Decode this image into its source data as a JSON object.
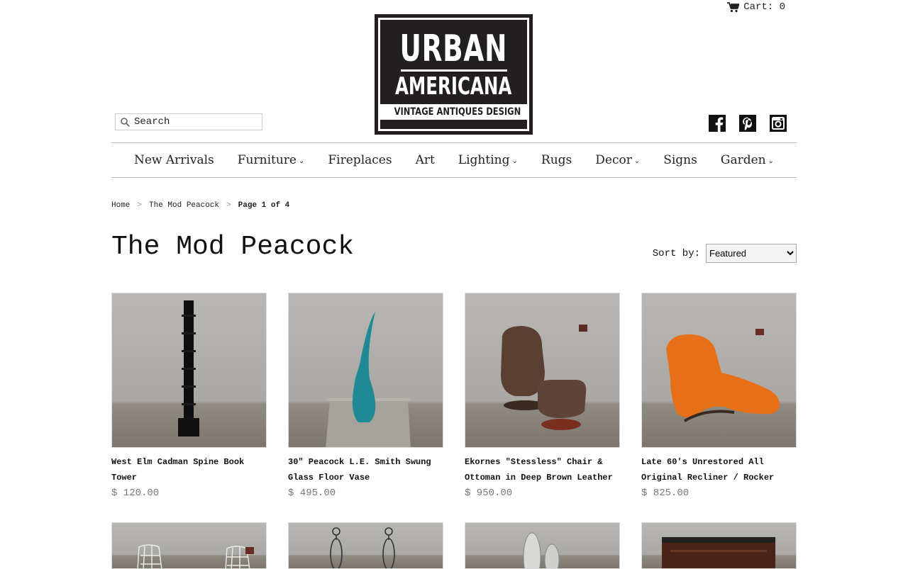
{
  "header": {
    "cart_label": "Cart: 0",
    "logo": {
      "line1": "URBAN",
      "line2": "AMERICANA",
      "tagline": "VINTAGE ANTIQUES DESIGN"
    },
    "search_placeholder": "Search",
    "social": [
      "facebook-icon",
      "pinterest-icon",
      "instagram-icon"
    ]
  },
  "nav": {
    "items": [
      {
        "label": "New Arrivals",
        "has_dropdown": false
      },
      {
        "label": "Furniture",
        "has_dropdown": true
      },
      {
        "label": "Fireplaces",
        "has_dropdown": false
      },
      {
        "label": "Art",
        "has_dropdown": false
      },
      {
        "label": "Lighting",
        "has_dropdown": true
      },
      {
        "label": "Rugs",
        "has_dropdown": false
      },
      {
        "label": "Decor",
        "has_dropdown": true
      },
      {
        "label": "Signs",
        "has_dropdown": false
      },
      {
        "label": "Garden",
        "has_dropdown": true
      }
    ]
  },
  "breadcrumb": {
    "home": "Home",
    "collection": "The Mod Peacock",
    "current": "Page 1 of 4",
    "separator": ">"
  },
  "page": {
    "title": "The Mod Peacock",
    "sort_label": "Sort by:",
    "sort_selected": "Featured"
  },
  "products": [
    {
      "title": "West Elm Cadman Spine Book Tower",
      "price": "$ 120.00"
    },
    {
      "title": "30\" Peacock L.E. Smith Swung Glass Floor Vase",
      "price": "$ 495.00"
    },
    {
      "title": "Ekornes \"Stessless\" Chair & Ottoman in Deep Brown Leather",
      "price": "$ 950.00"
    },
    {
      "title": "Late 60's Unrestored All Original Recliner / Rocker",
      "price": "$ 825.00"
    }
  ],
  "colors": {
    "logo_bg": "#231f20",
    "price": "#777777",
    "rule": "#bbbbbb"
  }
}
